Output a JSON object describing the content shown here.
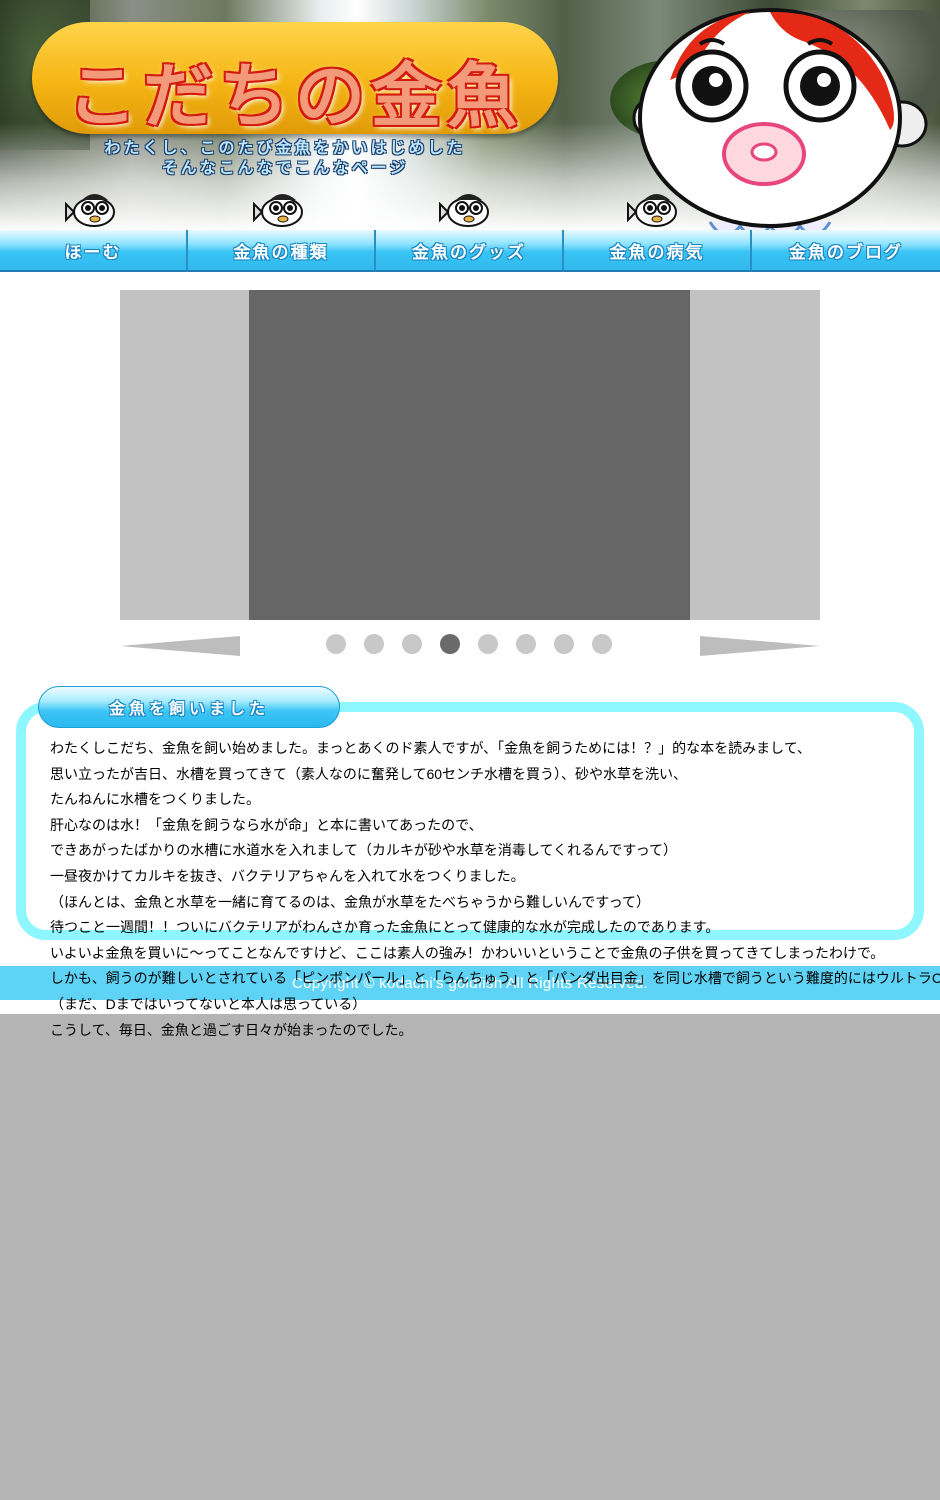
{
  "header": {
    "logo_text": "こだちの金魚",
    "tagline_line1": "わたくし、このたび金魚をかいはじめした",
    "tagline_line2": "そんなこんなでこんなページ",
    "colors": {
      "banner": "#f5b514",
      "logo_outline": "#d41b0f",
      "logo_fill": "#f39a7a"
    }
  },
  "nav": {
    "items": [
      {
        "label": "ほーむ"
      },
      {
        "label": "金魚の種類"
      },
      {
        "label": "金魚のグッズ"
      },
      {
        "label": "金魚の病気"
      },
      {
        "label": "金魚のブログ"
      }
    ]
  },
  "slider": {
    "dot_count": 8,
    "active_dot": 4,
    "prev_icon": "left-arrow-icon",
    "next_icon": "right-arrow-icon"
  },
  "article": {
    "title": "金魚を飼いました",
    "lines": [
      "わたくしこだち、金魚を飼い始めました。まっとあくのド素人ですが、「金魚を飼うためには！？」的な本を読みまして、",
      "思い立ったが吉日、水槽を買ってきて（素人なのに奮発して60センチ水槽を買う）、砂や水草を洗い、",
      "たんねんに水槽をつくりました。",
      "肝心なのは水！「金魚を飼うなら水が命」と本に書いてあったので、",
      "できあがったばかりの水槽に水道水を入れまして（カルキが砂や水草を消毒してくれるんですって）",
      "一昼夜かけてカルキを抜き、バクテリアちゃんを入れて水をつくりました。",
      "（ほんとは、金魚と水草を一緒に育てるのは、金魚が水草をたべちゃうから難しいんですって）",
      "待つこと一週間！！ついにバクテリアがわんさか育った金魚にとって健康的な水が完成したのであります。",
      "いよいよ金魚を買いに～ってことなんですけど、ここは素人の強み！かわいいということで金魚の子供を買ってきてしまったわけで。",
      "しかも、飼うのが難しいとされている「ピンポンパール」と「らんちゅう」と「パンダ出目金」を同じ水槽で飼うという難度的にはウルトラC級",
      "（まだ、Dまではいってないと本人は思っている）",
      "こうして、毎日、金魚と過ごす日々が始まったのでした。"
    ]
  },
  "footer": {
    "copyright": "Copyright © kodachi's goldfish All Rights Reserved."
  }
}
